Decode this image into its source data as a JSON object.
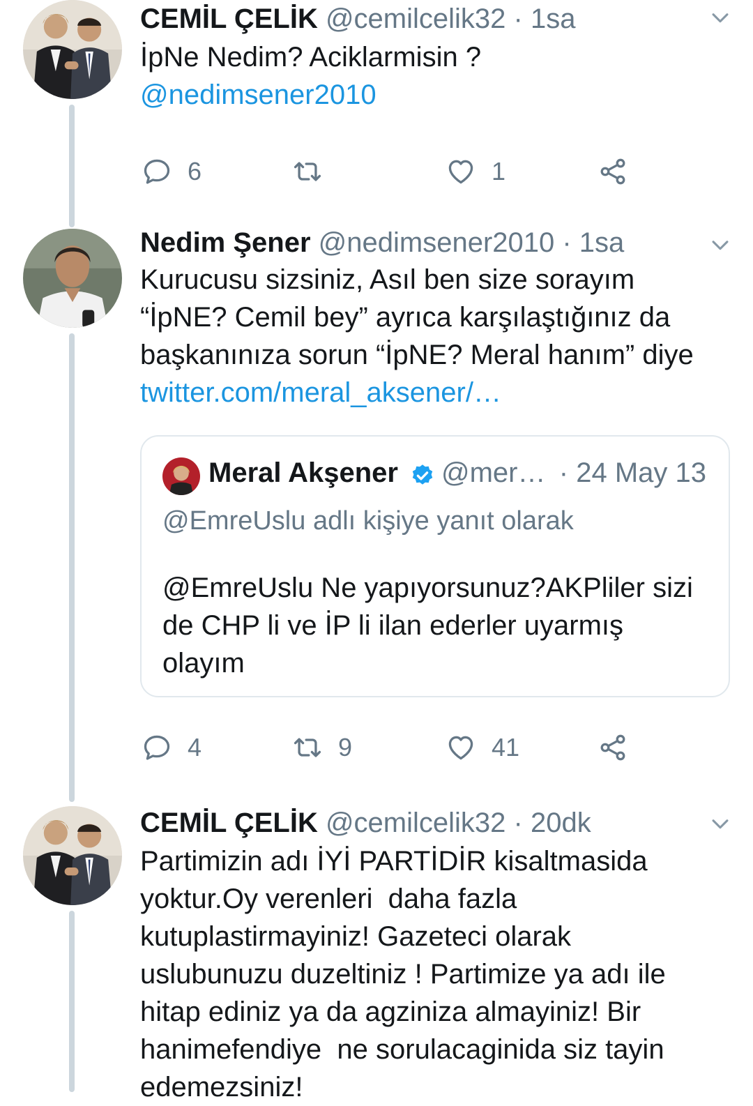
{
  "tweets": [
    {
      "name": "CEMİL ÇELİK",
      "handle": "@cemilcelik32",
      "time": "· 1sa",
      "text": "İpNe Nedim? Aciklarmisin ?",
      "link": "@nedimsener2010",
      "actions": {
        "reply": "6",
        "retweet": "",
        "like": "1"
      }
    },
    {
      "name": "Nedim Şener",
      "handle": "@nedimsener2010",
      "time": "· 1sa",
      "text_lines": [
        "Kurucusu sizsiniz, Asıl ben size sorayım",
        "“İpNE? Cemil bey” ayrıca karşılaştığınız da",
        "başkanınıza sorun “İpNE? Meral hanım” diye"
      ],
      "link": "twitter.com/meral_aksener/…",
      "quote": {
        "name": "Meral Akşener",
        "handle": "@mer…",
        "date": "· 24 May 13",
        "reply_to": "@EmreUslu adlı kişiye yanıt olarak",
        "text_lines": [
          "@EmreUslu Ne yapıyorsunuz?AKPliler sizi",
          "de CHP li ve İP li ilan ederler uyarmış",
          "olayım"
        ]
      },
      "actions": {
        "reply": "4",
        "retweet": "9",
        "like": "41"
      }
    },
    {
      "name": "CEMİL ÇELİK",
      "handle": "@cemilcelik32",
      "time": "· 20dk",
      "text_lines": [
        "Partimizin adı İYİ PARTİDİR kisaltmasida",
        "yoktur.Oy verenleri  daha fazla",
        "kutuplastirmayiniz! Gazeteci olarak",
        "uslubunuzu duzeltiniz ! Partimize ya adı ile",
        "hitap ediniz ya da agziniza almayiniz! Bir",
        "hanimefendiye  ne sorulacaginida siz tayin",
        "edemezsiniz!"
      ]
    }
  ],
  "colors": {
    "link": "#1b95e0",
    "muted": "#657786",
    "line": "#ccd6dd",
    "verified": "#1da1f2"
  },
  "icons": [
    "reply-icon",
    "retweet-icon",
    "like-icon",
    "share-icon",
    "chevron-down-icon",
    "verified-badge-icon"
  ]
}
